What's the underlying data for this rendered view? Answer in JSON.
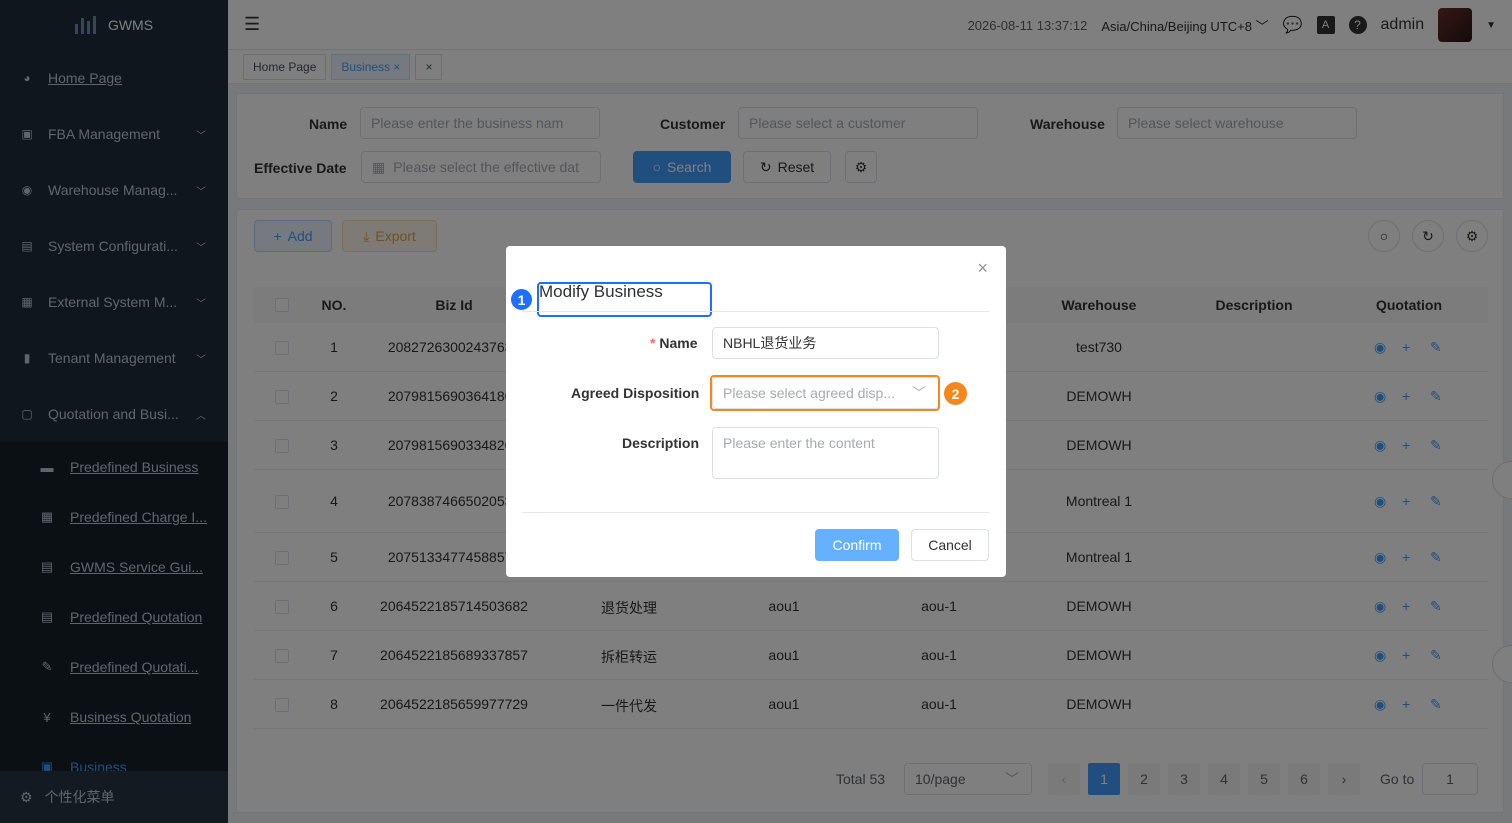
{
  "app": {
    "name": "GWMS"
  },
  "sidebar": {
    "items": [
      {
        "label": "Home Page",
        "icon": "dashboard-icon"
      },
      {
        "label": "FBA Management",
        "icon": "fba-icon"
      },
      {
        "label": "Warehouse Manag...",
        "icon": "warehouse-icon"
      },
      {
        "label": "System Configurati...",
        "icon": "system-icon"
      },
      {
        "label": "External System M...",
        "icon": "grid-icon"
      },
      {
        "label": "Tenant Management",
        "icon": "chart-icon"
      },
      {
        "label": "Quotation and Busi...",
        "icon": "quotation-icon"
      }
    ],
    "sub_items": [
      {
        "label": "Predefined Business"
      },
      {
        "label": "Predefined Charge I..."
      },
      {
        "label": "GWMS Service Gui..."
      },
      {
        "label": "Predefined Quotation"
      },
      {
        "label": "Predefined Quotati..."
      },
      {
        "label": "Business Quotation"
      },
      {
        "label": "Business"
      }
    ],
    "footer": "个性化菜单"
  },
  "header": {
    "datetime": "2026-08-11 13:37:12",
    "timezone": "Asia/China/Beijing UTC+8",
    "user": "admin"
  },
  "tags": {
    "home": "Home Page",
    "business": "Business"
  },
  "search": {
    "name_label": "Name",
    "name_placeholder": "Please enter the business nam",
    "customer_label": "Customer",
    "customer_placeholder": "Please select a customer",
    "warehouse_label": "Warehouse",
    "warehouse_placeholder": "Please select warehouse",
    "date_label": "Effective Date",
    "date_placeholder": "Please select the effective dat",
    "search_btn": "Search",
    "reset_btn": "Reset"
  },
  "toolbar": {
    "add": "Add",
    "export": "Export"
  },
  "table": {
    "headers": [
      "NO.",
      "Biz Id",
      "Warehouse",
      "Description",
      "Quotation"
    ],
    "rows": [
      {
        "no": "1",
        "biz_id": "20827263002437632",
        "name": "",
        "customer": "",
        "code": "",
        "warehouse": "test730"
      },
      {
        "no": "2",
        "biz_id": "20798156903641866",
        "name": "",
        "customer": "",
        "code": "",
        "warehouse": "DEMOWH"
      },
      {
        "no": "3",
        "biz_id": "20798156903348262",
        "name": "",
        "customer": "",
        "code": "",
        "warehouse": "DEMOWH"
      },
      {
        "no": "4",
        "biz_id": "20783874665020533",
        "name": "",
        "customer": "",
        "code": "",
        "warehouse": "Montreal 1"
      },
      {
        "no": "5",
        "biz_id": "20751334774588572",
        "name": "",
        "customer": "",
        "code": "",
        "warehouse": "Montreal 1"
      },
      {
        "no": "6",
        "biz_id": "2064522185714503682",
        "name": "退货处理",
        "customer": "aou1",
        "code": "aou-1",
        "warehouse": "DEMOWH"
      },
      {
        "no": "7",
        "biz_id": "2064522185689337857",
        "name": "拆柜转运",
        "customer": "aou1",
        "code": "aou-1",
        "warehouse": "DEMOWH"
      },
      {
        "no": "8",
        "biz_id": "2064522185659977729",
        "name": "一件代发",
        "customer": "aou1",
        "code": "aou-1",
        "warehouse": "DEMOWH"
      }
    ]
  },
  "pagination": {
    "total": "Total 53",
    "page_size": "10/page",
    "pages": [
      "1",
      "2",
      "3",
      "4",
      "5",
      "6"
    ],
    "goto_label": "Go to",
    "goto_value": "1"
  },
  "dialog": {
    "title": "Modify Business",
    "name_label": "Name",
    "name_value": "NBHL退货业务",
    "disposition_label": "Agreed Disposition",
    "disposition_placeholder": "Please select agreed disp...",
    "description_label": "Description",
    "description_placeholder": "Please enter the content",
    "confirm": "Confirm",
    "cancel": "Cancel"
  },
  "annotations": {
    "marker1": "1",
    "marker2": "2"
  },
  "colors": {
    "primary": "#409eff",
    "annotation_blue": "#1e6fff",
    "annotation_orange": "#f5871f",
    "sidebar_bg": "#1f2d3d"
  }
}
